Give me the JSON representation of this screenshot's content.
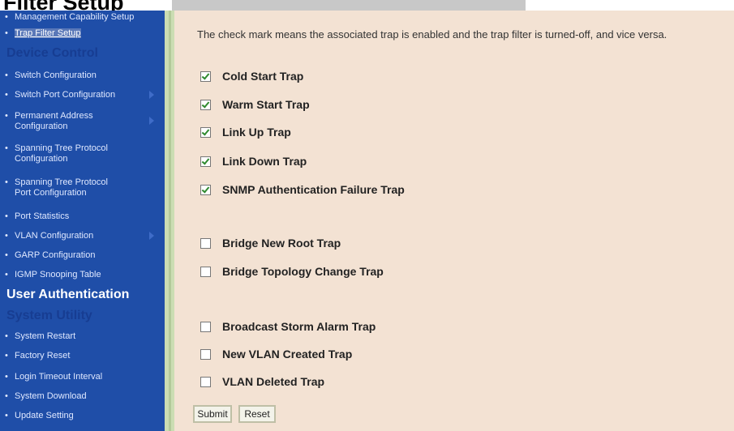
{
  "page_title": "Filter Setup",
  "sidebar": {
    "items": [
      {
        "label": "Management Capability Setup",
        "active": false
      },
      {
        "label": "Trap Filter Setup",
        "active": true
      },
      {
        "section": "Device Control"
      },
      {
        "label": "Switch Configuration"
      },
      {
        "label": "Switch Port Configuration",
        "has_arrow": true
      },
      {
        "label": "Permanent Address",
        "label2": "Configuration",
        "has_arrow": true
      },
      {
        "label": "Spanning Tree Protocol",
        "label2": "Configuration"
      },
      {
        "label": "Spanning Tree Protocol",
        "label2": "Port Configuration"
      },
      {
        "label": "Port Statistics"
      },
      {
        "label": "VLAN Configuration",
        "has_arrow": true
      },
      {
        "label": "GARP Configuration"
      },
      {
        "label": "IGMP Snooping Table"
      },
      {
        "section": "User Authentication"
      },
      {
        "section": "System Utility"
      },
      {
        "label": "System Restart"
      },
      {
        "label": "Factory Reset"
      },
      {
        "label": "Login Timeout Interval"
      },
      {
        "label": "System Download"
      },
      {
        "label": "Update Setting"
      }
    ]
  },
  "main": {
    "info": "The check mark means the associated trap is enabled and the trap filter is turned-off, and vice versa.",
    "traps": [
      {
        "label": "Cold Start Trap",
        "checked": true
      },
      {
        "label": "Warm Start Trap",
        "checked": true
      },
      {
        "label": "Link Up Trap",
        "checked": true
      },
      {
        "label": "Link Down Trap",
        "checked": true
      },
      {
        "label": "SNMP Authentication Failure Trap",
        "checked": true
      },
      {
        "label": "Bridge New Root Trap",
        "checked": false
      },
      {
        "label": "Bridge Topology Change Trap",
        "checked": false
      },
      {
        "label": "Broadcast Storm Alarm Trap",
        "checked": false
      },
      {
        "label": "New VLAN Created Trap",
        "checked": false
      },
      {
        "label": "VLAN Deleted Trap",
        "checked": false
      }
    ],
    "submit_label": "Submit",
    "reset_label": "Reset"
  },
  "colors": {
    "sidebar_bg": "#1f4ea8",
    "main_bg": "#f3e2d3",
    "checkmark": "#2f8a2f"
  }
}
